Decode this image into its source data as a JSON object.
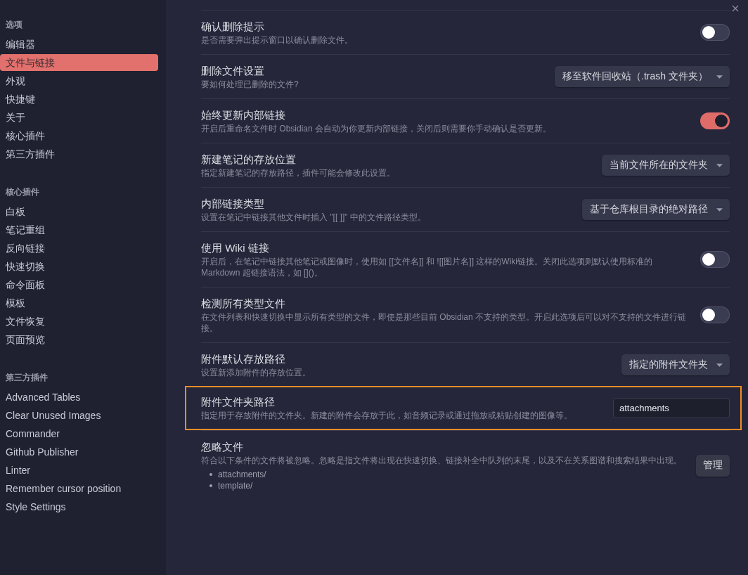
{
  "sidebar": {
    "sections": [
      {
        "heading": "选项",
        "items": [
          {
            "label": "编辑器",
            "selected": false
          },
          {
            "label": "文件与链接",
            "selected": true
          },
          {
            "label": "外观",
            "selected": false
          },
          {
            "label": "快捷键",
            "selected": false
          },
          {
            "label": "关于",
            "selected": false
          },
          {
            "label": "核心插件",
            "selected": false
          },
          {
            "label": "第三方插件",
            "selected": false
          }
        ]
      },
      {
        "heading": "核心插件",
        "items": [
          {
            "label": "白板",
            "selected": false
          },
          {
            "label": "笔记重组",
            "selected": false
          },
          {
            "label": "反向链接",
            "selected": false
          },
          {
            "label": "快速切换",
            "selected": false
          },
          {
            "label": "命令面板",
            "selected": false
          },
          {
            "label": "模板",
            "selected": false
          },
          {
            "label": "文件恢复",
            "selected": false
          },
          {
            "label": "页面预览",
            "selected": false
          }
        ]
      },
      {
        "heading": "第三方插件",
        "items": [
          {
            "label": "Advanced Tables",
            "selected": false
          },
          {
            "label": "Clear Unused Images",
            "selected": false
          },
          {
            "label": "Commander",
            "selected": false
          },
          {
            "label": "Github Publisher",
            "selected": false
          },
          {
            "label": "Linter",
            "selected": false
          },
          {
            "label": "Remember cursor position",
            "selected": false
          },
          {
            "label": "Style Settings",
            "selected": false
          }
        ]
      }
    ]
  },
  "settings": [
    {
      "name": "确认删除提示",
      "description": "是否需要弹出提示窗口以确认删除文件。",
      "kind": "toggle",
      "on": false,
      "highlighted": false
    },
    {
      "name": "删除文件设置",
      "description": "要如何处理已删除的文件?",
      "kind": "dropdown",
      "value": "移至软件回收站（.trash 文件夹）",
      "highlighted": false
    },
    {
      "name": "始终更新内部链接",
      "description": "开启后重命名文件时 Obsidian 会自动为你更新内部链接，关闭后则需要你手动确认是否更新。",
      "kind": "toggle",
      "on": true,
      "highlighted": false
    },
    {
      "name": "新建笔记的存放位置",
      "description": "指定新建笔记的存放路径，插件可能会修改此设置。",
      "kind": "dropdown",
      "value": "当前文件所在的文件夹",
      "highlighted": false
    },
    {
      "name": "内部链接类型",
      "description": "设置在笔记中链接其他文件时插入 \"[[ ]]\" 中的文件路径类型。",
      "kind": "dropdown",
      "value": "基于仓库根目录的绝对路径",
      "highlighted": false
    },
    {
      "name": "使用 Wiki 链接",
      "description": "开启后，在笔记中链接其他笔记或图像时，使用如 [[文件名]] 和 ![[图片名]] 这样的Wiki链接。关闭此选项则默认使用标准的 Markdown 超链接语法，如 []()。",
      "kind": "toggle",
      "on": false,
      "highlighted": false
    },
    {
      "name": "检测所有类型文件",
      "description": "在文件列表和快速切换中显示所有类型的文件，即使是那些目前 Obsidian 不支持的类型。开启此选项后可以对不支持的文件进行链接。",
      "kind": "toggle",
      "on": false,
      "highlighted": false
    },
    {
      "name": "附件默认存放路径",
      "description": "设置新添加附件的存放位置。",
      "kind": "dropdown",
      "value": "指定的附件文件夹",
      "highlighted": false
    },
    {
      "name": "附件文件夹路径",
      "description": "指定用于存放附件的文件夹。新建的附件会存放于此，如音频记录或通过拖放或粘贴创建的图像等。",
      "kind": "text",
      "value": "attachments",
      "highlighted": true
    },
    {
      "name": "忽略文件",
      "description": "符合以下条件的文件将被忽略。忽略是指文件将出现在快速切换、链接补全中队列的末尾，以及不在关系图谱和搜索结果中出现。",
      "kind": "button",
      "list": [
        "attachments/",
        "template/"
      ],
      "button": "管理",
      "highlighted": false
    }
  ]
}
